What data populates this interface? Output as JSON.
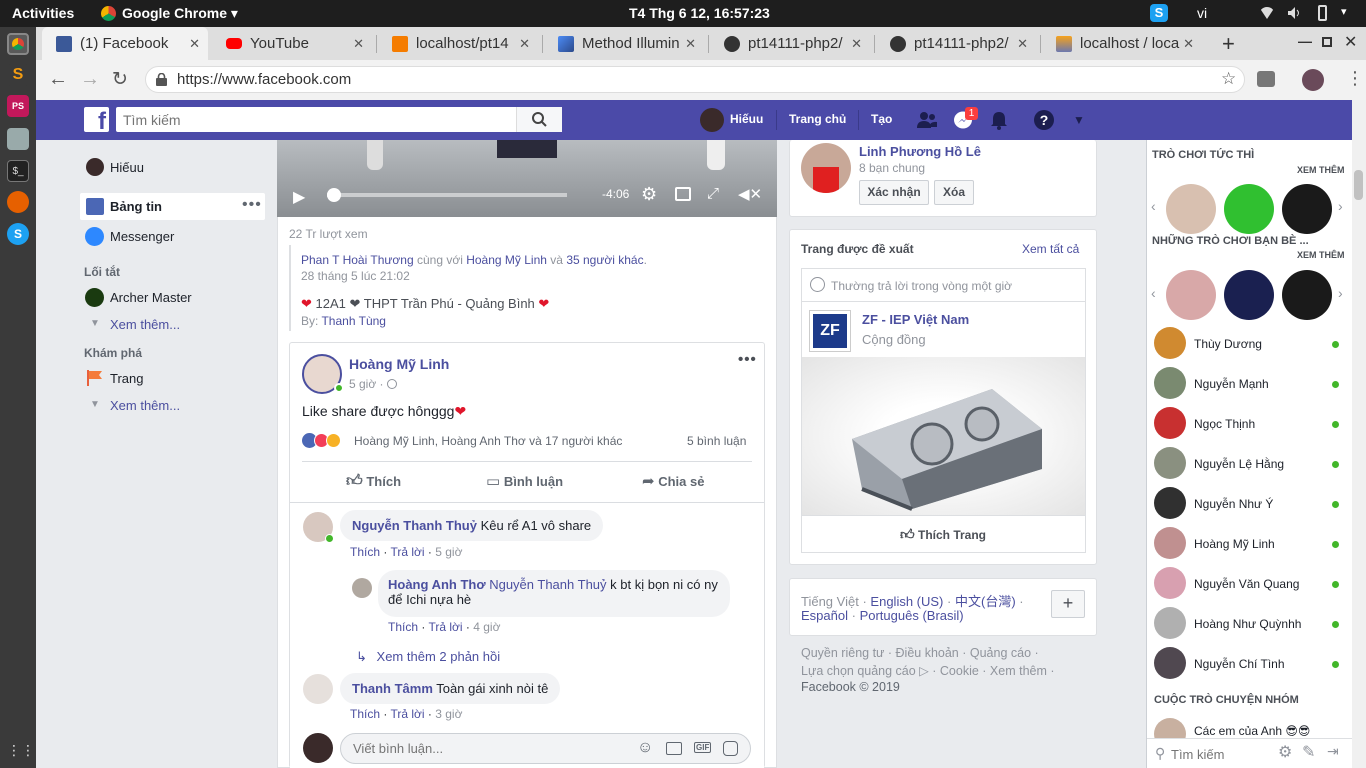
{
  "os": {
    "activities": "Activities",
    "app": "Google Chrome",
    "clock": "T4 Thg 6 12, 16:57:23",
    "lang": "vi"
  },
  "tabs": [
    {
      "label": "(1) Facebook"
    },
    {
      "label": "YouTube"
    },
    {
      "label": "localhost/pt14"
    },
    {
      "label": "Method Illumin"
    },
    {
      "label": "pt14111-php2/"
    },
    {
      "label": "pt14111-php2/"
    },
    {
      "label": "localhost / loca"
    }
  ],
  "url": "https://www.facebook.com",
  "fb": {
    "search_placeholder": "Tìm kiếm",
    "user": "Hiếuu",
    "home": "Trang chủ",
    "create": "Tạo",
    "msg_badge": "1"
  },
  "left": {
    "profile": "Hiếuu",
    "news_feed": "Bảng tin",
    "messenger": "Messenger",
    "shortcuts_title": "Lối tắt",
    "archer": "Archer Master",
    "see_more": "Xem thêm...",
    "explore_title": "Khám phá",
    "pages": "Trang",
    "see_more2": "Xem thêm..."
  },
  "video": {
    "time": "-4:06"
  },
  "prev_post": {
    "views": "22 Tr lượt xem",
    "author": "Phan T Hoài Thương",
    "with": "cùng với",
    "tagged": "Hoàng Mỹ Linh",
    "and": "và",
    "others": "35 người khác",
    "date": "28 tháng 5 lúc 21:02",
    "text": "12A1 ❤ THPT Trần Phú - Quảng Bình",
    "by": "By:",
    "by_name": "Thanh Tùng"
  },
  "post": {
    "author": "Hoàng Mỹ Linh",
    "time": "5 giờ",
    "text": "Like share được hônggg",
    "reactions": "Hoàng Mỹ Linh, Hoàng Anh Thơ và 17 người khác",
    "comments_count": "5 bình luận",
    "like": "Thích",
    "comment": "Bình luận",
    "share": "Chia sẻ"
  },
  "comments": [
    {
      "name": "Nguyễn Thanh Thuỷ",
      "text": "Kêu rể A1 vô share",
      "like": "Thích",
      "reply": "Trả lời",
      "time": "5 giờ"
    },
    {
      "name": "Hoàng Anh Thơ",
      "tag": "Nguyễn Thanh Thuỷ",
      "text1": "k bt kị bọn ni có ny",
      "text2": "để Ichi nựa hè",
      "like": "Thích",
      "reply": "Trả lời",
      "time": "4 giờ"
    },
    {
      "name": "Thanh Tâmm",
      "text": "Toàn gái xinh nòi tê",
      "like": "Thích",
      "reply": "Trả lời",
      "time": "3 giờ"
    }
  ],
  "more_replies": "Xem thêm 2 phản hồi",
  "write_comment": "Viết bình luận...",
  "friend_req": {
    "name": "Linh Phương Hồ Lê",
    "mutual": "8 bạn chung",
    "confirm": "Xác nhận",
    "delete": "Xóa"
  },
  "suggested": {
    "title": "Trang được đề xuất",
    "see_all": "Xem tất cả",
    "reply_note": "Thường trả lời trong vòng một giờ",
    "page_name": "ZF - IEP Việt Nam",
    "page_cat": "Cộng đồng",
    "like_page": "Thích Trang"
  },
  "languages": {
    "current": "Tiếng Việt",
    "l1": "English (US)",
    "l2": "中文(台灣)",
    "l3": "Español",
    "l4": "Português (Brasil)"
  },
  "footer": {
    "line1": "Quyền riêng tư · Điều khoản · Quảng cáo ·",
    "line2": "Lựa chọn quảng cáo ▷ · Cookie · Xem thêm ·",
    "line3": "Facebook © 2019"
  },
  "sidebar": {
    "instant_games": "TRÒ CHƠI TỨC THÌ",
    "see_more": "XEM THÊM",
    "friends_games": "NHỮNG TRÒ CHƠI BẠN BÈ ...",
    "see_more2": "XEM THÊM",
    "contacts": [
      {
        "name": "Thùy Dương",
        "color": "#d08a30"
      },
      {
        "name": "Nguyễn Mạnh",
        "color": "#7a8a70"
      },
      {
        "name": "Ngọc Thịnh",
        "color": "#c83030"
      },
      {
        "name": "Nguyễn Lệ Hằng",
        "color": "#8a9080"
      },
      {
        "name": "Nguyễn Như Ý",
        "color": "#303030"
      },
      {
        "name": "Hoàng Mỹ Linh",
        "color": "#c09090"
      },
      {
        "name": "Nguyễn Văn Quang",
        "color": "#d8a0b0"
      },
      {
        "name": "Hoàng Như Quỳnhh",
        "color": "#b0b0b0"
      },
      {
        "name": "Nguyễn Chí Tình",
        "color": "#504850"
      }
    ],
    "group_title": "CUỘC TRÒ CHUYỆN NHÓM",
    "group1": "Các em của Anh 😎😎",
    "search": "Tìm kiếm"
  }
}
